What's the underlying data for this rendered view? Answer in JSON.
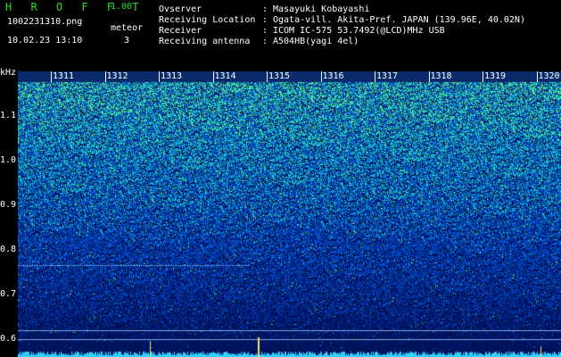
{
  "header": {
    "app_title": "H R O F F T",
    "version": "1.00",
    "filename": "1002231310.png",
    "meteor_label": "meteor",
    "datetime": "10.02.23 13:10",
    "meteor_count": "3"
  },
  "info": [
    {
      "key": "Ovserver",
      "value": "Masayuki Kobayashi"
    },
    {
      "key": "Receiving Location",
      "value": "Ogata-vill. Akita-Pref. JAPAN (139.96E, 40.02N)"
    },
    {
      "key": "Receiver",
      "value": "ICOM IC-575 53.7492(@LCD)MHz USB"
    },
    {
      "key": "Receiving antenna",
      "value": "A504HB(yagi 4el)"
    }
  ],
  "spectrogram": {
    "unit": "kHz",
    "x_ticks": [
      "1311",
      "1312",
      "1313",
      "1314",
      "1315",
      "1316",
      "1317",
      "1318",
      "1319",
      "1320"
    ],
    "y_ticks": [
      "1.1",
      "1.0",
      "0.9",
      "0.8",
      "0.7",
      "0.6"
    ]
  },
  "colors": {
    "background": "#000000",
    "title": "#20e020",
    "noise_low": "#001a5a",
    "noise_high": "#40ff80",
    "baseline": "#30d0ff"
  }
}
